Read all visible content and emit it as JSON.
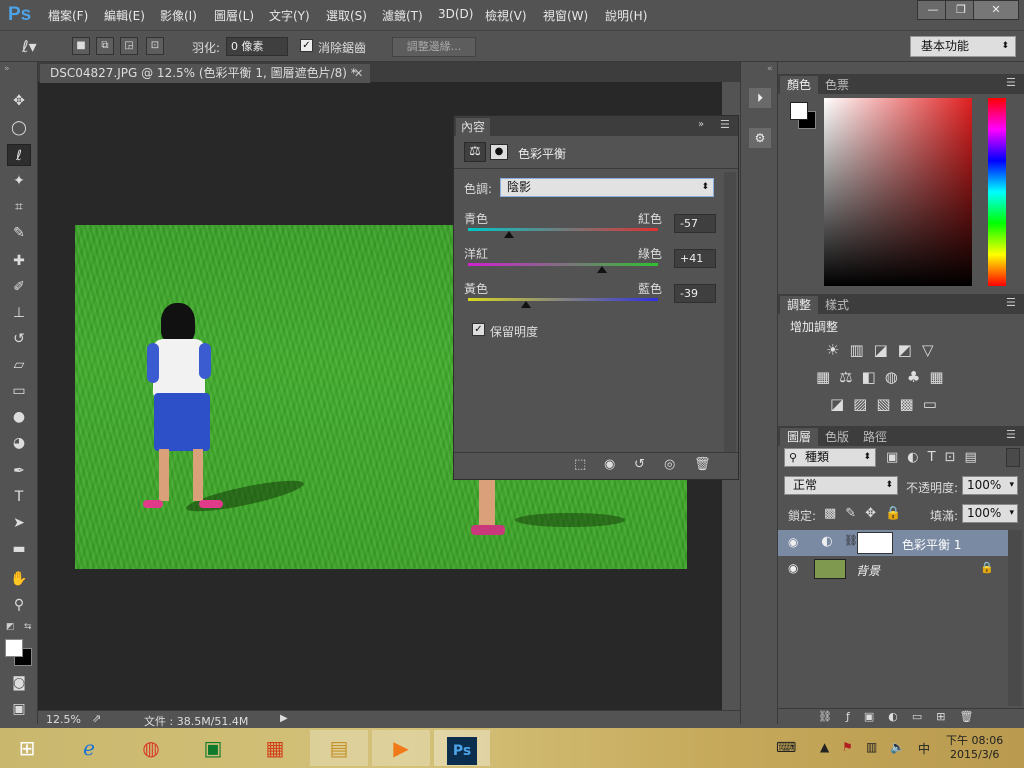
{
  "app": {
    "logo": "Ps",
    "menu": [
      "檔案(F)",
      "編輯(E)",
      "影像(I)",
      "圖層(L)",
      "文字(Y)",
      "選取(S)",
      "濾鏡(T)",
      "3D(D)",
      "檢視(V)",
      "視窗(W)",
      "說明(H)"
    ],
    "window_controls": [
      "—",
      "❐",
      "✕"
    ]
  },
  "options": {
    "feather_label": "羽化:",
    "feather_value": "0 像素",
    "antialias_label": "消除鋸齒",
    "antialias_checked": true,
    "refine_edge": "調整邊緣...",
    "workspace": "基本功能"
  },
  "document": {
    "tab_title": "DSC04827.JPG @ 12.5% (色彩平衡 1, 圖層遮色片/8) *",
    "zoom": "12.5%",
    "file_info": "文件 : 38.5M/51.4M"
  },
  "properties": {
    "tab": "內容",
    "title": "色彩平衡",
    "tone_label": "色調:",
    "tone_value": "陰影",
    "sliders": [
      {
        "left": "青色",
        "right": "紅色",
        "value": "-57",
        "numeric": -57,
        "left_color": "#00c8c8",
        "right_color": "#e03030"
      },
      {
        "left": "洋紅",
        "right": "綠色",
        "value": "+41",
        "numeric": 41,
        "left_color": "#d020d0",
        "right_color": "#30c030"
      },
      {
        "left": "黃色",
        "right": "藍色",
        "value": "-39",
        "numeric": -39,
        "left_color": "#d8d820",
        "right_color": "#3030e0"
      }
    ],
    "preserve_label": "保留明度",
    "preserve_checked": true
  },
  "color_panel": {
    "tabs": [
      "顏色",
      "色票"
    ],
    "active_tab": "顏色"
  },
  "adjust_panel": {
    "tabs": [
      "調整",
      "樣式"
    ],
    "active_tab": "調整",
    "heading": "增加調整"
  },
  "layers_panel": {
    "tabs": [
      "圖層",
      "色版",
      "路徑"
    ],
    "active_tab": "圖層",
    "filter_kind": "種類",
    "blend_mode": "正常",
    "opacity_label": "不透明度:",
    "opacity_value": "100%",
    "lock_label": "鎖定:",
    "fill_label": "填滿:",
    "fill_value": "100%",
    "layers": [
      {
        "name": "色彩平衡 1",
        "selected": true
      },
      {
        "name": "背景",
        "selected": false
      }
    ]
  },
  "taskbar": {
    "ime": "中",
    "time": "下午 08:06",
    "date": "2015/3/6"
  }
}
